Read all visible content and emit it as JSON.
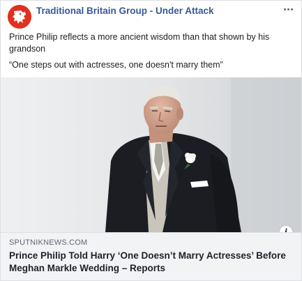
{
  "post": {
    "page_name": "Traditional Britain Group - Under Attack",
    "text_line1": "Prince Philip reflects a more ancient wisdom than that shown by his grandson",
    "text_line2": "“One steps out with actresses, one doesn't marry them”",
    "photo_icon": "photo-of-man-in-morning-suit",
    "colors": {
      "page_name": "#385898",
      "avatar": "#e1301f",
      "link_box": "#f2f3f5"
    }
  },
  "link": {
    "domain": "SPUTNIKNEWS.COM",
    "title": "Prince Philip Told Harry ‘One Doesn’t Marry Actresses’ Before Meghan Markle Wedding – Reports",
    "info_label": "i"
  },
  "icons": {
    "avatar": "lion-logo-icon",
    "more": "more-options-icon",
    "info": "info-icon"
  }
}
